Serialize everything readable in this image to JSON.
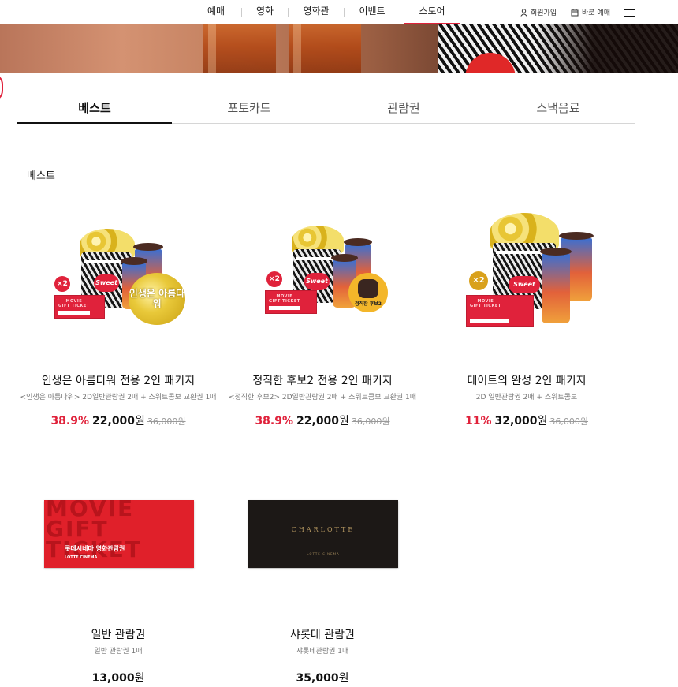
{
  "nav": {
    "items": [
      "예매",
      "영화",
      "영화관",
      "이벤트",
      "스토어"
    ],
    "active": "스토어",
    "signup": "회원가입",
    "quick_booking": "바로 예매"
  },
  "tabs": [
    "베스트",
    "포토카드",
    "관람권",
    "스낵음료"
  ],
  "active_tab": "베스트",
  "section_title": "베스트",
  "products": [
    {
      "name": "인생은 아름다워 전용 2인 패키지",
      "desc": "<인생은 아름다워> 2D일반관람권 2매 + 스위트콤보 교환권 1매",
      "discount": "38.9%",
      "price": "22,000",
      "won": "원",
      "original": "36,000원",
      "badge": "×2",
      "badge_color": "#e0223b",
      "movie_label": "인생은 아름다워"
    },
    {
      "name": "정직한 후보2 전용 2인 패키지",
      "desc": "<정직한 후보2> 2D일반관람권 2매 + 스위트콤보 교환권 1매",
      "discount": "38.9%",
      "price": "22,000",
      "won": "원",
      "original": "36,000원",
      "badge": "×2",
      "badge_color": "#e0223b",
      "movie_label": "정직한 후보2"
    },
    {
      "name": "데이트의 완성 2인 패키지",
      "desc": "2D 일반관람권 2매 + 스위트콤보",
      "discount": "11%",
      "price": "32,000",
      "won": "원",
      "original": "36,000원",
      "badge": "×2",
      "badge_color": "#d9a11c"
    },
    {
      "name": "일반 관람권",
      "desc": "일반 관람권 1매",
      "price": "13,000",
      "won": "원",
      "ticket_big": "MOVIE GIFT TICKET",
      "ticket_title": "롯데시네마 영화관람권",
      "ticket_logo": "LOTTE CINEMA"
    },
    {
      "name": "샤롯데 관람권",
      "desc": "샤롯데관람권 1매",
      "price": "35,000",
      "won": "원",
      "ticket_title": "CHARLOTTE",
      "ticket_logo": "LOTTE CINEMA"
    }
  ],
  "colors": {
    "accent": "#e0223b",
    "text": "#111111",
    "muted": "#777777"
  }
}
